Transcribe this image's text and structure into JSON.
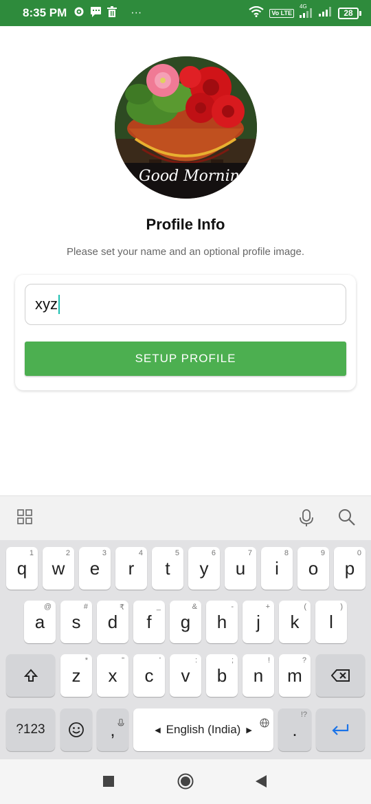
{
  "status_bar": {
    "time": "8:35 PM",
    "icons_left": [
      "settings-icon",
      "message-icon",
      "delete-icon",
      "more-icon"
    ],
    "dots": "···",
    "volte": "Vo LTE",
    "network": "4G",
    "battery": "28"
  },
  "profile": {
    "avatar_caption": "Good Morning",
    "title": "Profile Info",
    "subtitle": "Please set your name and an optional profile image.",
    "name_value": "xyz",
    "setup_button": "SETUP PROFILE"
  },
  "colors": {
    "status_bar": "#2e8b3c",
    "button": "#4caf50",
    "caret": "#1bbfb0"
  },
  "keyboard": {
    "row1": [
      {
        "k": "q",
        "h": "1"
      },
      {
        "k": "w",
        "h": "2"
      },
      {
        "k": "e",
        "h": "3"
      },
      {
        "k": "r",
        "h": "4"
      },
      {
        "k": "t",
        "h": "5"
      },
      {
        "k": "y",
        "h": "6"
      },
      {
        "k": "u",
        "h": "7"
      },
      {
        "k": "i",
        "h": "8"
      },
      {
        "k": "o",
        "h": "9"
      },
      {
        "k": "p",
        "h": "0"
      }
    ],
    "row2": [
      {
        "k": "a",
        "h": "@"
      },
      {
        "k": "s",
        "h": "#"
      },
      {
        "k": "d",
        "h": "₹"
      },
      {
        "k": "f",
        "h": "_"
      },
      {
        "k": "g",
        "h": "&"
      },
      {
        "k": "h",
        "h": "-"
      },
      {
        "k": "j",
        "h": "+"
      },
      {
        "k": "k",
        "h": "("
      },
      {
        "k": "l",
        "h": ")"
      }
    ],
    "row3": [
      {
        "k": "z",
        "h": "*"
      },
      {
        "k": "x",
        "h": "\""
      },
      {
        "k": "c",
        "h": "'"
      },
      {
        "k": "v",
        "h": ":"
      },
      {
        "k": "b",
        "h": ";"
      },
      {
        "k": "n",
        "h": "!"
      },
      {
        "k": "m",
        "h": "?"
      }
    ],
    "symbols_key": "?123",
    "comma_key": ",",
    "space_label": "English (India)",
    "period_key": ".",
    "period_hint": "!?"
  }
}
